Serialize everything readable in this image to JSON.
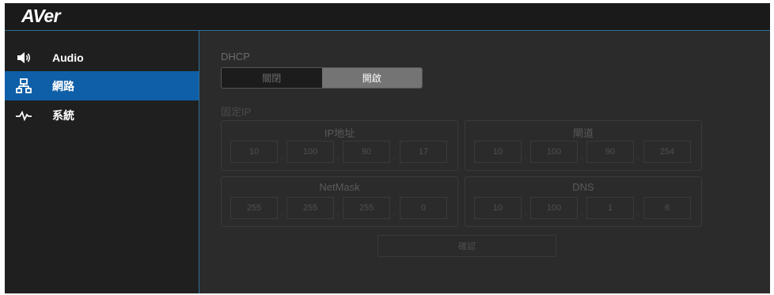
{
  "header": {
    "logo": "AVer"
  },
  "sidebar": {
    "items": [
      {
        "label": "Audio",
        "icon": "speaker-icon"
      },
      {
        "label": "網路",
        "icon": "network-icon"
      },
      {
        "label": "系統",
        "icon": "pulse-icon"
      }
    ],
    "active_index": 1
  },
  "main": {
    "dhcp": {
      "label": "DHCP",
      "off": "關閉",
      "on": "開啟",
      "selected": "開啟"
    },
    "static_ip_label": "固定IP",
    "ip": {
      "title": "IP地址",
      "octets": [
        "10",
        "100",
        "90",
        "17"
      ]
    },
    "gateway": {
      "title": "閘道",
      "octets": [
        "10",
        "100",
        "90",
        "254"
      ]
    },
    "netmask": {
      "title": "NetMask",
      "octets": [
        "255",
        "255",
        "255",
        "0"
      ]
    },
    "dns": {
      "title": "DNS",
      "octets": [
        "10",
        "100",
        "1",
        "6"
      ]
    },
    "confirm_label": "確認",
    "separator": "."
  },
  "colors": {
    "accent": "#0f5fa8",
    "border_accent": "#2d6f9a",
    "background": "#2b2b2b",
    "sidebar": "#1f1f1f"
  }
}
